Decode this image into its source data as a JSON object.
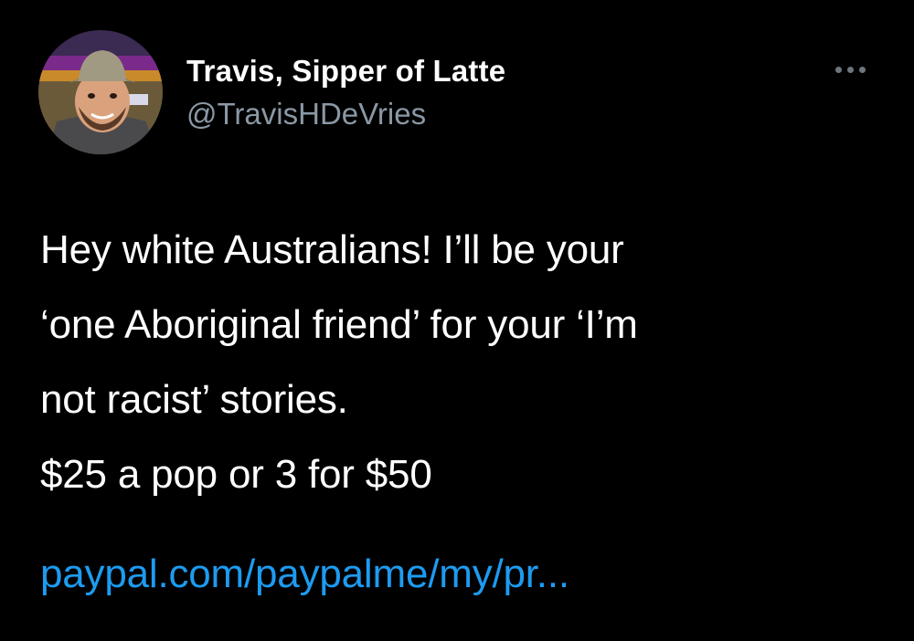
{
  "tweet": {
    "author": {
      "display_name": "Travis, Sipper of Latte",
      "handle": "@TravisHDeVries"
    },
    "more_icon": "more-horizontal-icon",
    "text_lines": [
      "Hey white Australians! I’ll be your",
      "‘one Aboriginal friend’ for your ‘I’m",
      "not racist’ stories.",
      "$25 a pop or 3 for $50"
    ],
    "link": "paypal.com/paypalme/my/pr..."
  },
  "colors": {
    "background": "#000000",
    "text": "#ffffff",
    "secondary_text": "#8b98a5",
    "link": "#1d9bf0"
  }
}
